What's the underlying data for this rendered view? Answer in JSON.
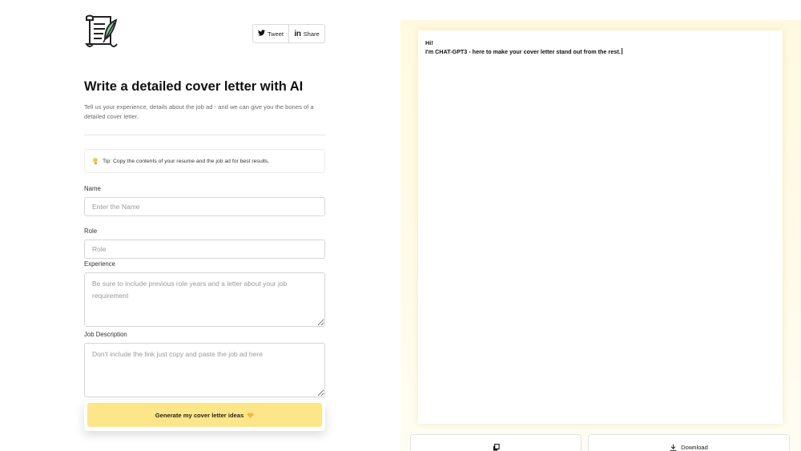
{
  "header": {
    "logo_icon": "scroll-quill-icon",
    "tweet_label": "Tweet",
    "share_label": "Share",
    "linkedin_glyph": "in"
  },
  "intro": {
    "title": "Write a detailed cover letter with AI",
    "subtitle": "Tell us your experience, details about the job ad - and we can give you the bones of a detailed cover letter."
  },
  "tip": {
    "icon": "lightbulb-icon",
    "text": "Tip: Copy the contents of your resume and the job ad for best results."
  },
  "form": {
    "name": {
      "label": "Name",
      "placeholder": "Enter the Name",
      "value": ""
    },
    "role": {
      "label": "Role",
      "placeholder": "Role",
      "value": ""
    },
    "experience": {
      "label": "Experience",
      "placeholder": "Be sure to include previous role years and a letter about your job requirement",
      "value": ""
    },
    "job_description": {
      "label": "Job Description",
      "placeholder": "Don't include the link just copy and paste the job ad here",
      "value": ""
    },
    "submit_label": "Generate my cover letter ideas"
  },
  "output": {
    "line1": "Hi!",
    "line2": "I'm CHAT-GPT3 - here to make your cover letter stand out from the rest."
  },
  "actions": {
    "copy_icon": "clipboard-icon",
    "download_icon": "download-icon",
    "download_label": "Download"
  },
  "colors": {
    "accent": "#fde68a",
    "panel_bg": "#fff9e0",
    "heart": "#f6b73c"
  }
}
